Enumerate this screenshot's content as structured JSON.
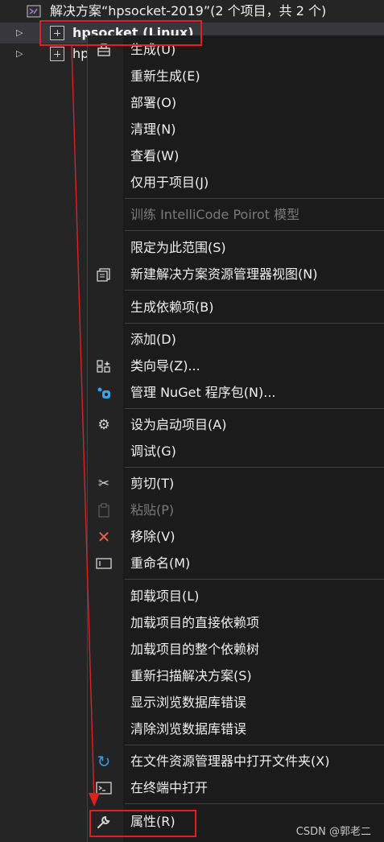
{
  "tree": {
    "solution_label": "解决方案“hpsocket-2019”(2 个项目，共 2 个)",
    "project1_label": "hpsocket (Linux)",
    "project2_label": "hp"
  },
  "menu": {
    "items": [
      {
        "label": "生成(U)",
        "icon": "build-icon"
      },
      {
        "label": "重新生成(E)"
      },
      {
        "label": "部署(O)"
      },
      {
        "label": "清理(N)"
      },
      {
        "label": "查看(W)"
      },
      {
        "label": "仅用于项目(J)"
      },
      {
        "label": "训练 IntelliCode Poirot 模型",
        "disabled": true
      },
      {
        "label": "限定为此范围(S)"
      },
      {
        "label": "新建解决方案资源管理器视图(N)",
        "icon": "new-view-icon"
      },
      {
        "label": "生成依赖项(B)"
      },
      {
        "label": "添加(D)"
      },
      {
        "label": "类向导(Z)...",
        "icon": "class-wizard-icon"
      },
      {
        "label": "管理 NuGet 程序包(N)...",
        "icon": "nuget-icon"
      },
      {
        "label": "设为启动项目(A)",
        "icon": "gear-icon"
      },
      {
        "label": "调试(G)"
      },
      {
        "label": "剪切(T)",
        "icon": "scissors-icon"
      },
      {
        "label": "粘贴(P)",
        "icon": "paste-icon",
        "disabled": true
      },
      {
        "label": "移除(V)",
        "icon": "close-icon"
      },
      {
        "label": "重命名(M)",
        "icon": "rename-icon"
      },
      {
        "label": "卸载项目(L)"
      },
      {
        "label": "加载项目的直接依赖项"
      },
      {
        "label": "加载项目的整个依赖树"
      },
      {
        "label": "重新扫描解决方案(S)"
      },
      {
        "label": "显示浏览数据库错误"
      },
      {
        "label": "清除浏览数据库错误"
      },
      {
        "label": "在文件资源管理器中打开文件夹(X)",
        "icon": "refresh-arrow-icon"
      },
      {
        "label": "在终端中打开",
        "icon": "terminal-icon"
      },
      {
        "label": "属性(R)",
        "icon": "wrench-icon"
      }
    ]
  },
  "watermark": "CSDN @郭老二",
  "colors": {
    "annotation": "#e02020",
    "remove_icon": "#e0604a",
    "nuget_icon": "#3aa0e8",
    "refresh_icon": "#3a96dd"
  }
}
